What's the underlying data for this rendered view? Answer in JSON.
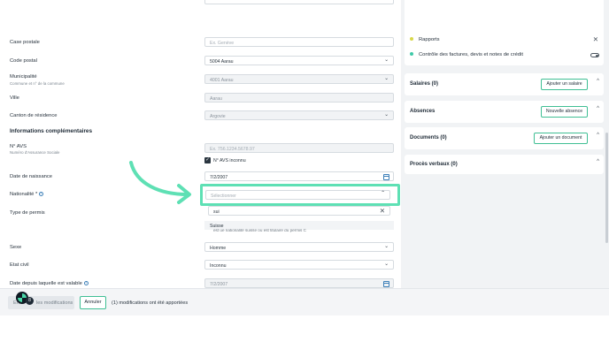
{
  "form": {
    "postal_box": {
      "label": "Case postale",
      "placeholder": "Ex. Genève"
    },
    "postal_code": {
      "label": "Code postal",
      "value": "5004 Aarau"
    },
    "municipality": {
      "label": "Municipalité",
      "sublabel": "Commune et n° de la commune",
      "value": "4001 Aarau"
    },
    "city": {
      "label": "Ville",
      "value": "Aarau"
    },
    "canton": {
      "label": "Canton de résidence",
      "value": "Argovie"
    },
    "section_title": "Informations complémentaires",
    "avs": {
      "label": "N° AVS",
      "sublabel": "Numéro d'Assurance Sociale",
      "placeholder": "Ex. 756.1234.5678.97"
    },
    "avs_unknown": {
      "label": "N° AVS inconnu",
      "check": "✓"
    },
    "birthdate": {
      "label": "Date de naissance",
      "value": "7/2/2007"
    },
    "nationality": {
      "label": "Nationalité *",
      "placeholder": "Sélectionner",
      "info": "i"
    },
    "nationality_search": {
      "value": "sui",
      "clear": "✕"
    },
    "nationality_hint": "est ue nationalité suisse ou est titulaire du permis C",
    "nationality_option": "Suisse",
    "permit": {
      "label": "Type de permis"
    },
    "sex": {
      "label": "Sexe",
      "value": "Homme"
    },
    "civil_status": {
      "label": "Etat civil",
      "value": "Inconnu"
    },
    "valid_since": {
      "label": "Date depuis laquelle est valable",
      "info": "i",
      "value": "7/2/2007"
    }
  },
  "footer": {
    "save_prefix": "En",
    "save_suffix": "les modifications",
    "cancel": "Annuler",
    "status": "(1) modifications ont été apportées",
    "badge": "8"
  },
  "right": {
    "reports_label": "Rapports",
    "control_label": "Contrôle des factures, devis et notes de crédit",
    "close": "✕",
    "salaries": {
      "title": "Salaires (0)",
      "button": "Ajouter un salaire"
    },
    "absences": {
      "title": "Absences",
      "button": "Nouvelle absence"
    },
    "documents": {
      "title": "Documents (0)",
      "button": "Ajouter un document"
    },
    "minutes": {
      "title": "Procès verbaux (0)"
    },
    "chevron_up": "^"
  },
  "colors": {
    "accent": "#5ee0b4",
    "reports_dot": "#d8d84a",
    "control_dot": "#3fc9a8"
  }
}
